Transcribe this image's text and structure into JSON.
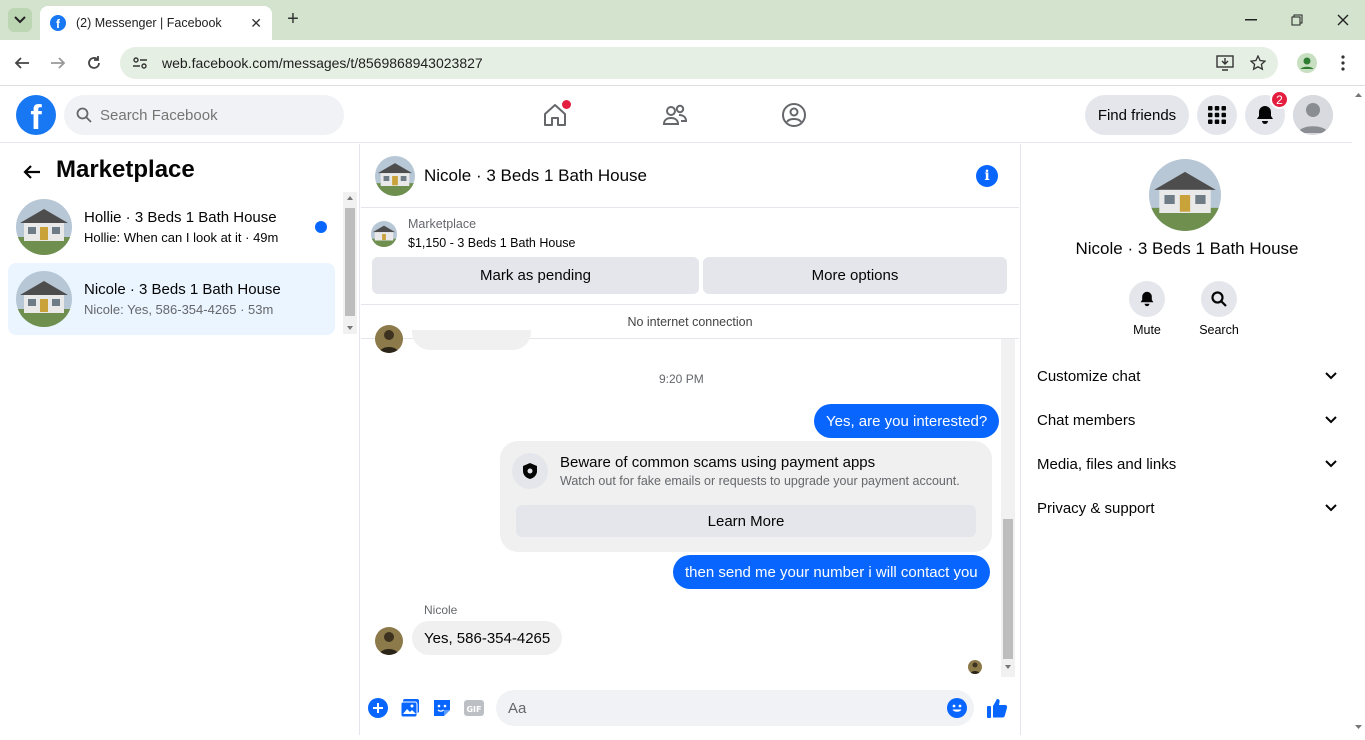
{
  "browser": {
    "tab_title": "(2) Messenger | Facebook",
    "url": "web.facebook.com/messages/t/8569868943023827"
  },
  "fb": {
    "search_placeholder": "Search Facebook",
    "find_friends": "Find friends",
    "notification_count": "2",
    "brand_color": "#1877f2"
  },
  "left": {
    "title": "Marketplace",
    "conversations": [
      {
        "name": "Hollie · 3 Beds 1 Bath House",
        "preview": "Hollie: When can I look at it · 49m",
        "unread": true
      },
      {
        "name": "Nicole · 3 Beds 1 Bath House",
        "preview": "Nicole: Yes, 586-354-4265 · 53m",
        "unread": false
      }
    ]
  },
  "chat": {
    "title": "Nicole · 3 Beds 1 Bath House",
    "listing_label": "Marketplace",
    "listing_detail": "$1,150 - 3 Beds 1 Bath House",
    "mark_pending": "Mark as pending",
    "more_options": "More options",
    "connection_status": "No internet connection",
    "timestamp": "9:20 PM",
    "messages": {
      "out1": "Yes, are you interested?",
      "out2": "then send me your number i will contact you",
      "in1": "Yes, 586-354-4265"
    },
    "scam_notice": {
      "title": "Beware of common scams using payment apps",
      "desc": "Watch out for fake emails or requests to upgrade your payment account.",
      "button": "Learn More"
    },
    "sender_name": "Nicole",
    "composer_placeholder": "Aa",
    "accent_color": "#0866ff"
  },
  "right": {
    "name": "Nicole · 3 Beds 1 Bath House",
    "mute": "Mute",
    "search": "Search",
    "sections": [
      "Customize chat",
      "Chat members",
      "Media, files and links",
      "Privacy & support"
    ]
  }
}
